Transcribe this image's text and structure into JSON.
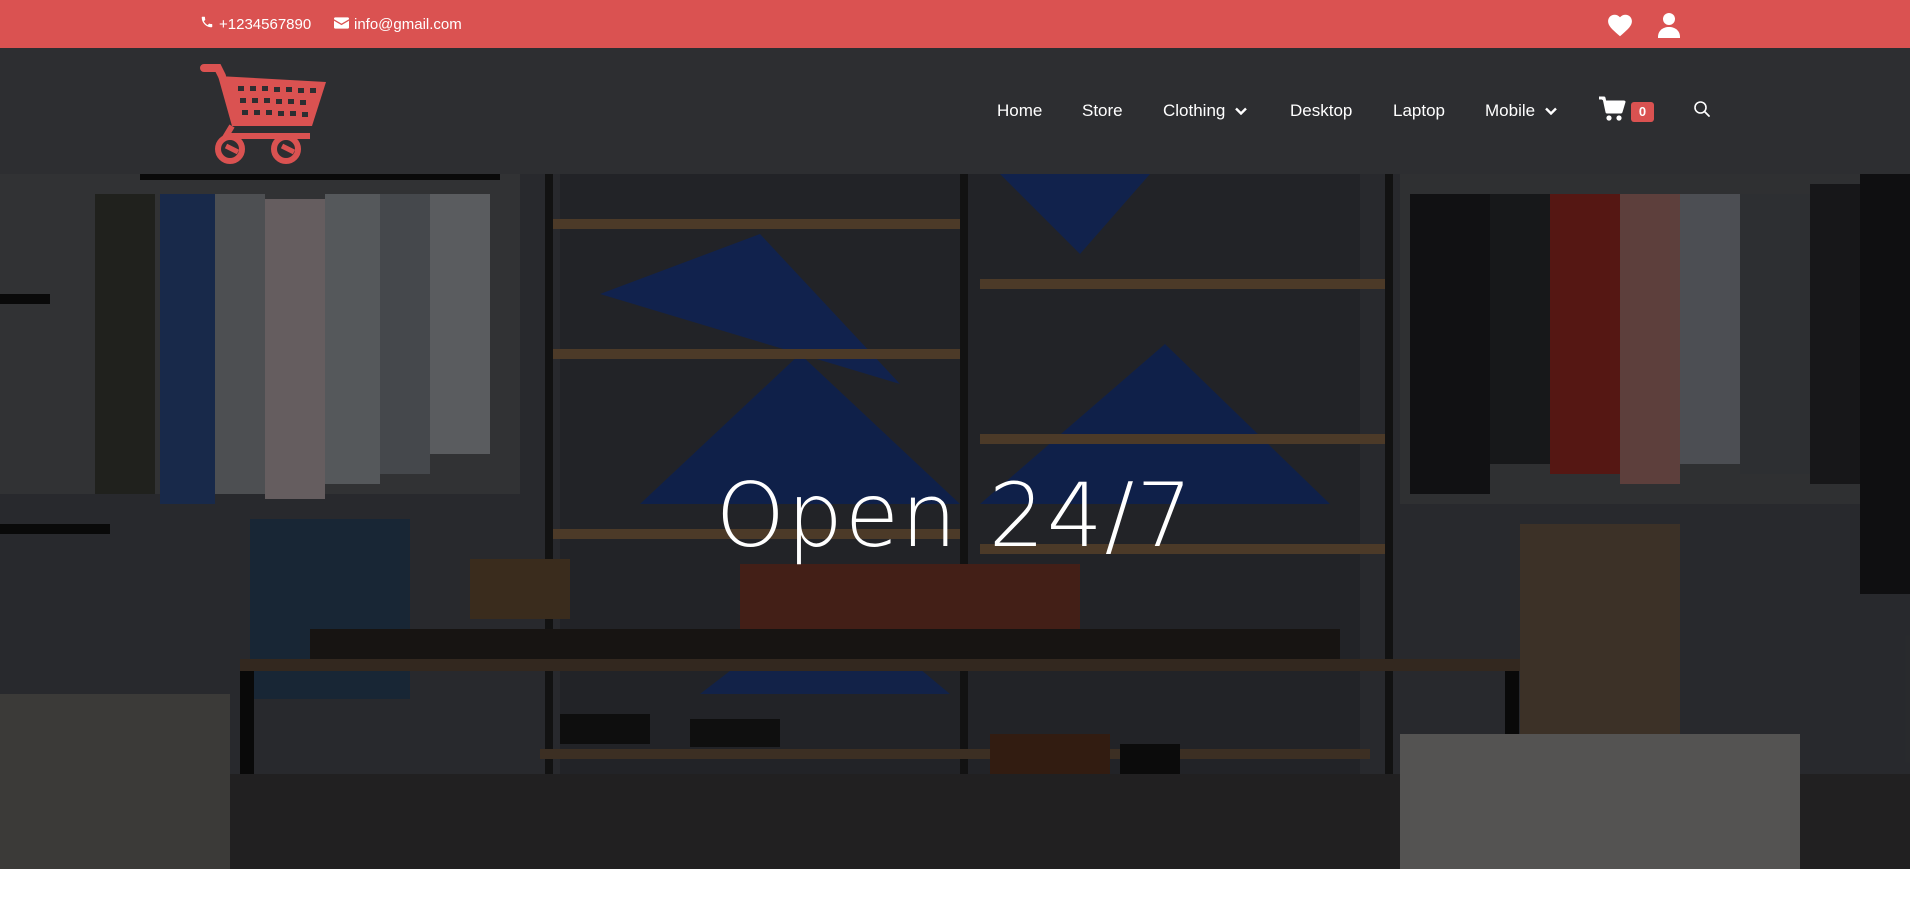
{
  "topbar": {
    "phone": "+1234567890",
    "email": "info@gmail.com",
    "phone_icon": "phone-icon",
    "email_icon": "envelope-icon",
    "wishlist_icon": "heart-icon",
    "account_icon": "user-icon"
  },
  "nav": {
    "items": [
      {
        "label": "Home"
      },
      {
        "label": "Store"
      },
      {
        "label": "Clothing",
        "dropdown": true
      },
      {
        "label": "Desktop"
      },
      {
        "label": "Laptop"
      },
      {
        "label": "Mobile",
        "dropdown": true
      }
    ],
    "cart_count": "0",
    "cart_icon": "shopping-cart-icon",
    "search_icon": "search-icon"
  },
  "hero": {
    "title": "Open 24/7"
  },
  "colors": {
    "accent": "#da5251",
    "header_bg": "#2d2e31",
    "text": "#ffffff"
  }
}
